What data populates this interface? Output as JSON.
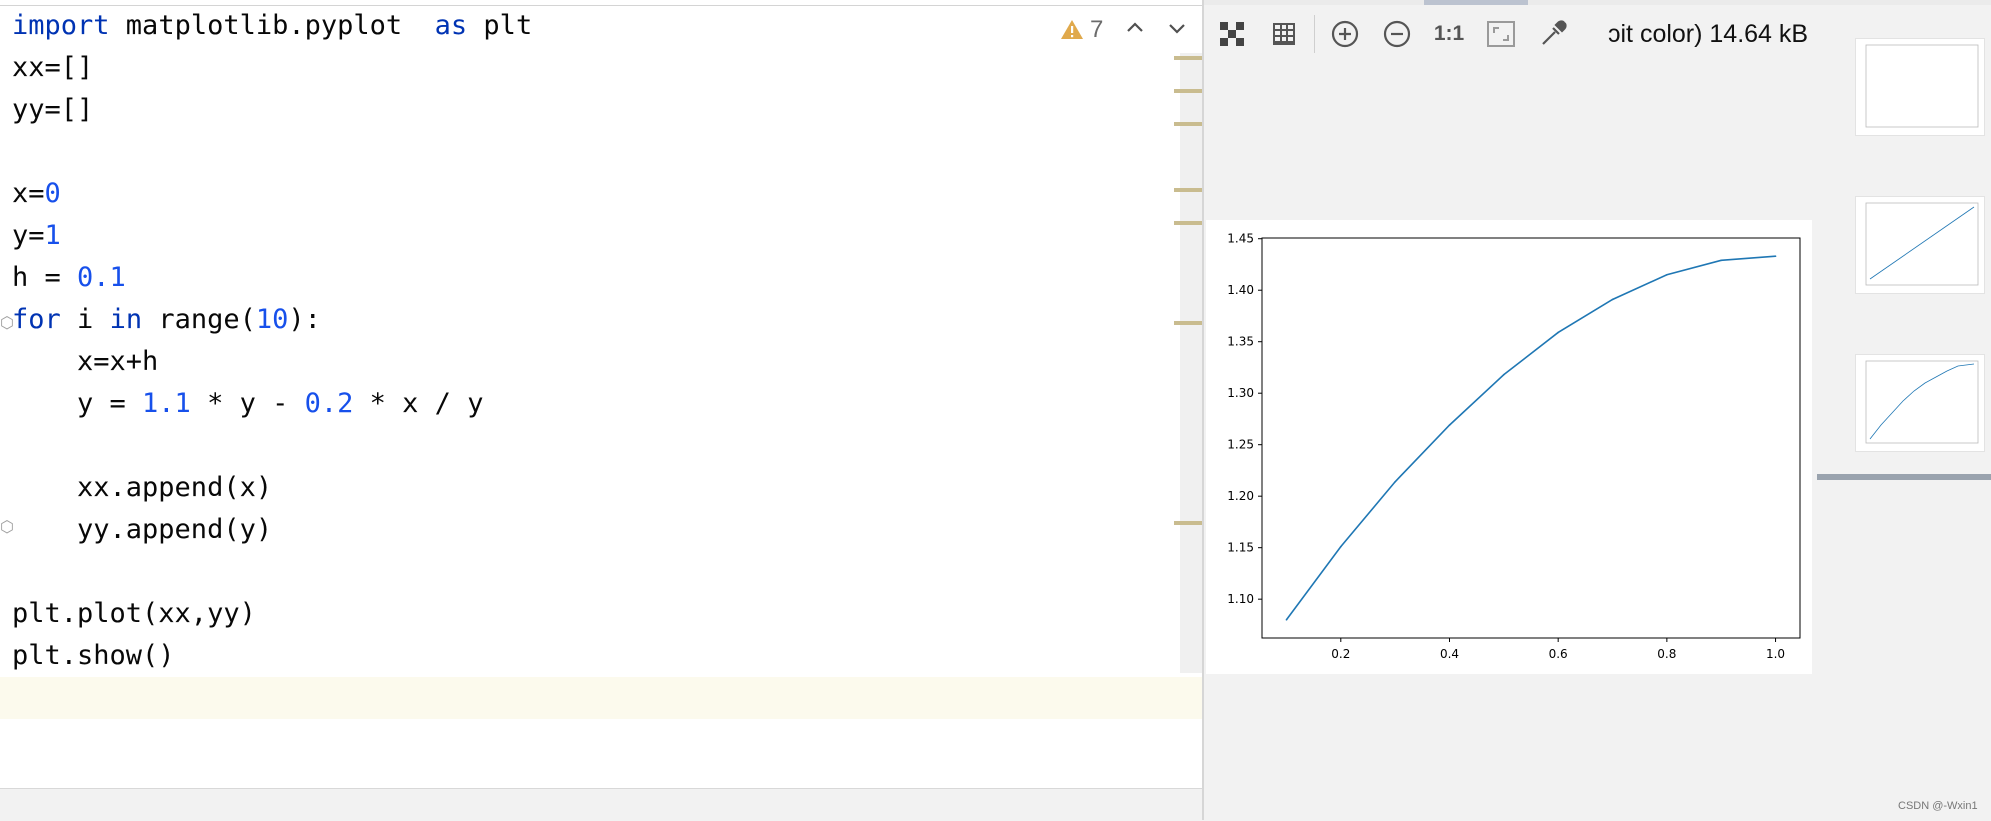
{
  "editor": {
    "lines": [
      {
        "text": "import matplotlib.pyplot  as plt"
      },
      {
        "text": "xx=[]"
      },
      {
        "text": "yy=[]"
      },
      {
        "text": ""
      },
      {
        "text": "x=0"
      },
      {
        "text": "y=1"
      },
      {
        "text": "h = 0.1"
      },
      {
        "text": "for i in range(10):"
      },
      {
        "text": "    x=x+h"
      },
      {
        "text": "    y = 1.1 * y - 0.2 * x / y"
      },
      {
        "text": ""
      },
      {
        "text": "    xx.append(x)"
      },
      {
        "text": "    yy.append(y)"
      },
      {
        "text": ""
      },
      {
        "text": "plt.plot(xx,yy)"
      },
      {
        "text": "plt.show()"
      }
    ],
    "warnings_count": "7"
  },
  "viewer": {
    "toolbar": {
      "transparency_icon": "checkerboard-icon",
      "grid_icon": "grid-icon",
      "zoom_in_icon": "zoom-in-icon",
      "zoom_out_icon": "zoom-out-icon",
      "actual_size_label": "1:1",
      "fit_icon": "fit-to-window-icon",
      "color_picker_icon": "eyedropper-icon"
    },
    "image_info": "ɔit color) 14.64 kB"
  },
  "chart_data": {
    "type": "line",
    "x": [
      0.1,
      0.2,
      0.3,
      0.4,
      0.5,
      0.6,
      0.7,
      0.8,
      0.9,
      1.0
    ],
    "series": [
      {
        "values": [
          1.08,
          1.151,
          1.214,
          1.269,
          1.318,
          1.359,
          1.391,
          1.415,
          1.429,
          1.433
        ]
      }
    ],
    "xticks": [
      "0.2",
      "0.4",
      "0.6",
      "0.8",
      "1.0"
    ],
    "yticks": [
      "1.10",
      "1.15",
      "1.20",
      "1.25",
      "1.30",
      "1.35",
      "1.40",
      "1.45"
    ],
    "xlim": [
      0.055,
      1.045
    ],
    "ylim": [
      1.0623,
      1.4507
    ],
    "color": "#1f77b4"
  },
  "watermark": "CSDN @-Wxin1"
}
